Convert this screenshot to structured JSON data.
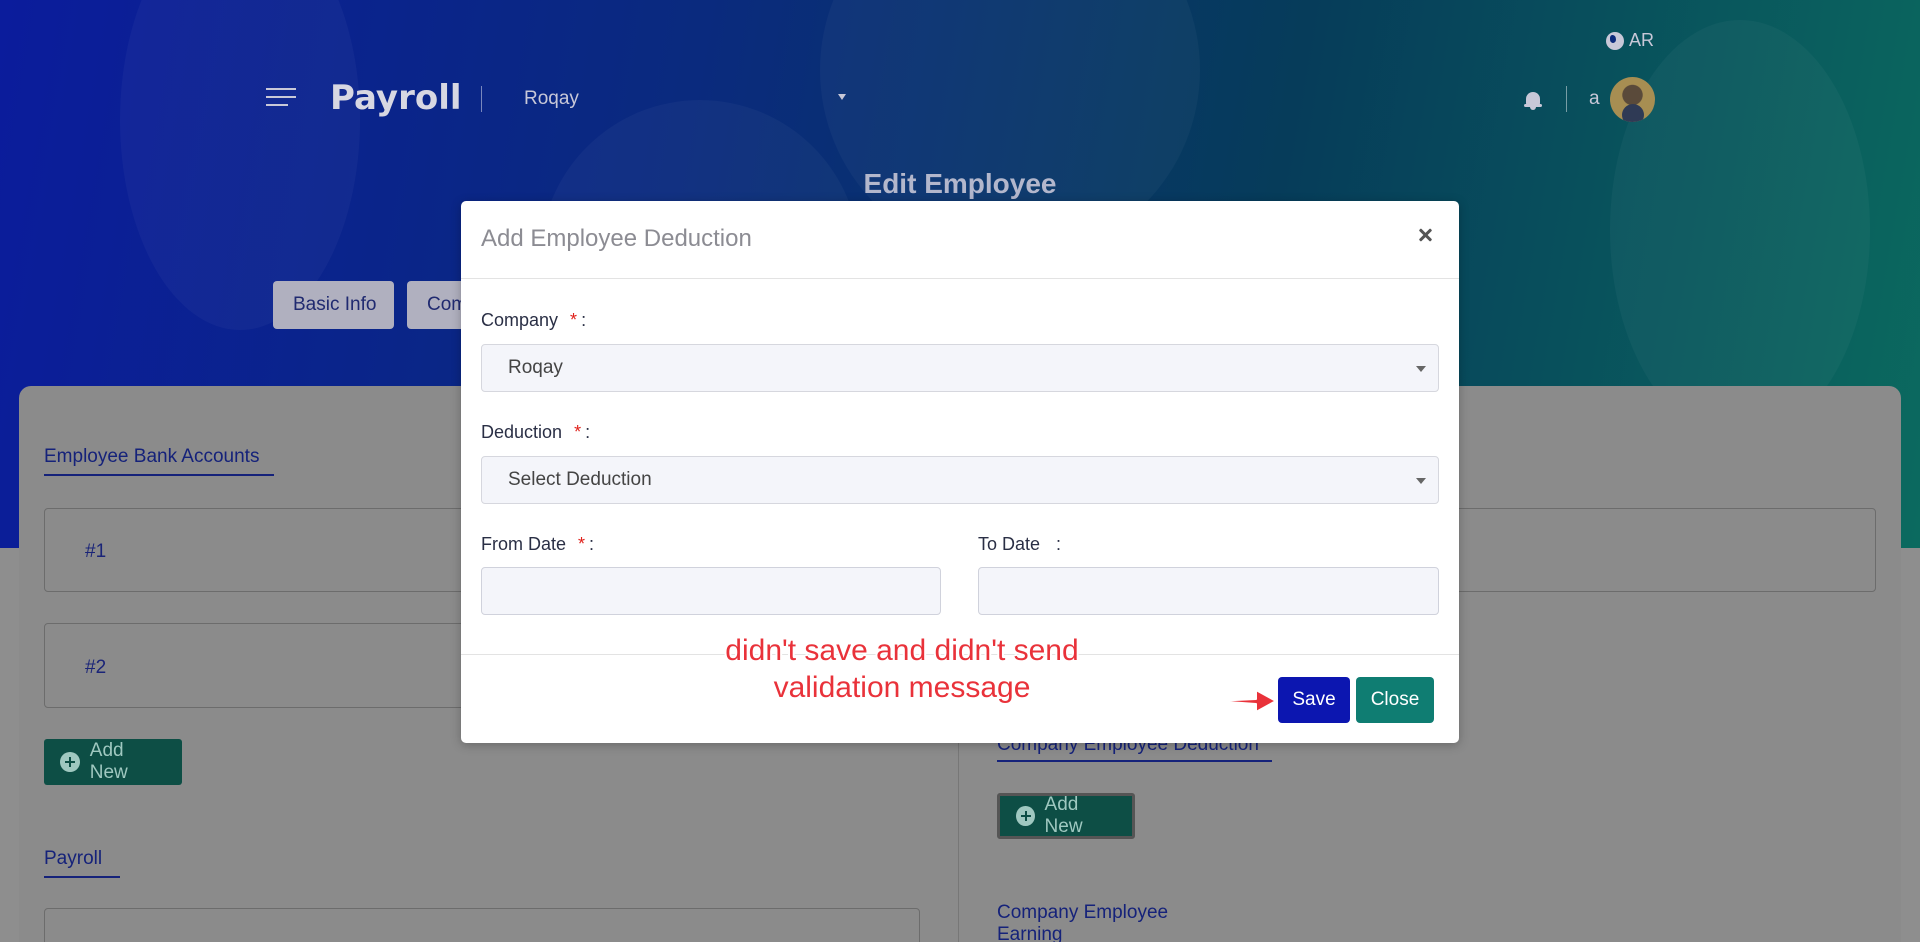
{
  "header": {
    "language": "AR",
    "brand": "Payroll",
    "company_selected": "Roqay",
    "user_name": "a",
    "page_title": "Edit Employee"
  },
  "tabs": [
    {
      "label": "Basic Info"
    },
    {
      "label": "Com"
    }
  ],
  "background": {
    "section_bank_accounts": "Employee Bank Accounts",
    "accounts": [
      "#1",
      "#2"
    ],
    "add_new": "Add New",
    "section_payroll": "Payroll",
    "section_company_deduction": "Company Employee Deduction",
    "add_new_right": "Add New",
    "section_company_earning": "Company Employee Earning"
  },
  "modal": {
    "title": "Add Employee Deduction",
    "company_label": "Company",
    "company_value": "Roqay",
    "deduction_label": "Deduction",
    "deduction_placeholder": "Select Deduction",
    "from_date_label": "From Date",
    "to_date_label": "To Date",
    "required_mark": "*",
    "colon": ":",
    "save_label": "Save",
    "close_label": "Close"
  },
  "annotation": {
    "line1": "didn't save and didn't send",
    "line2": "validation message",
    "color": "#e9323a"
  }
}
